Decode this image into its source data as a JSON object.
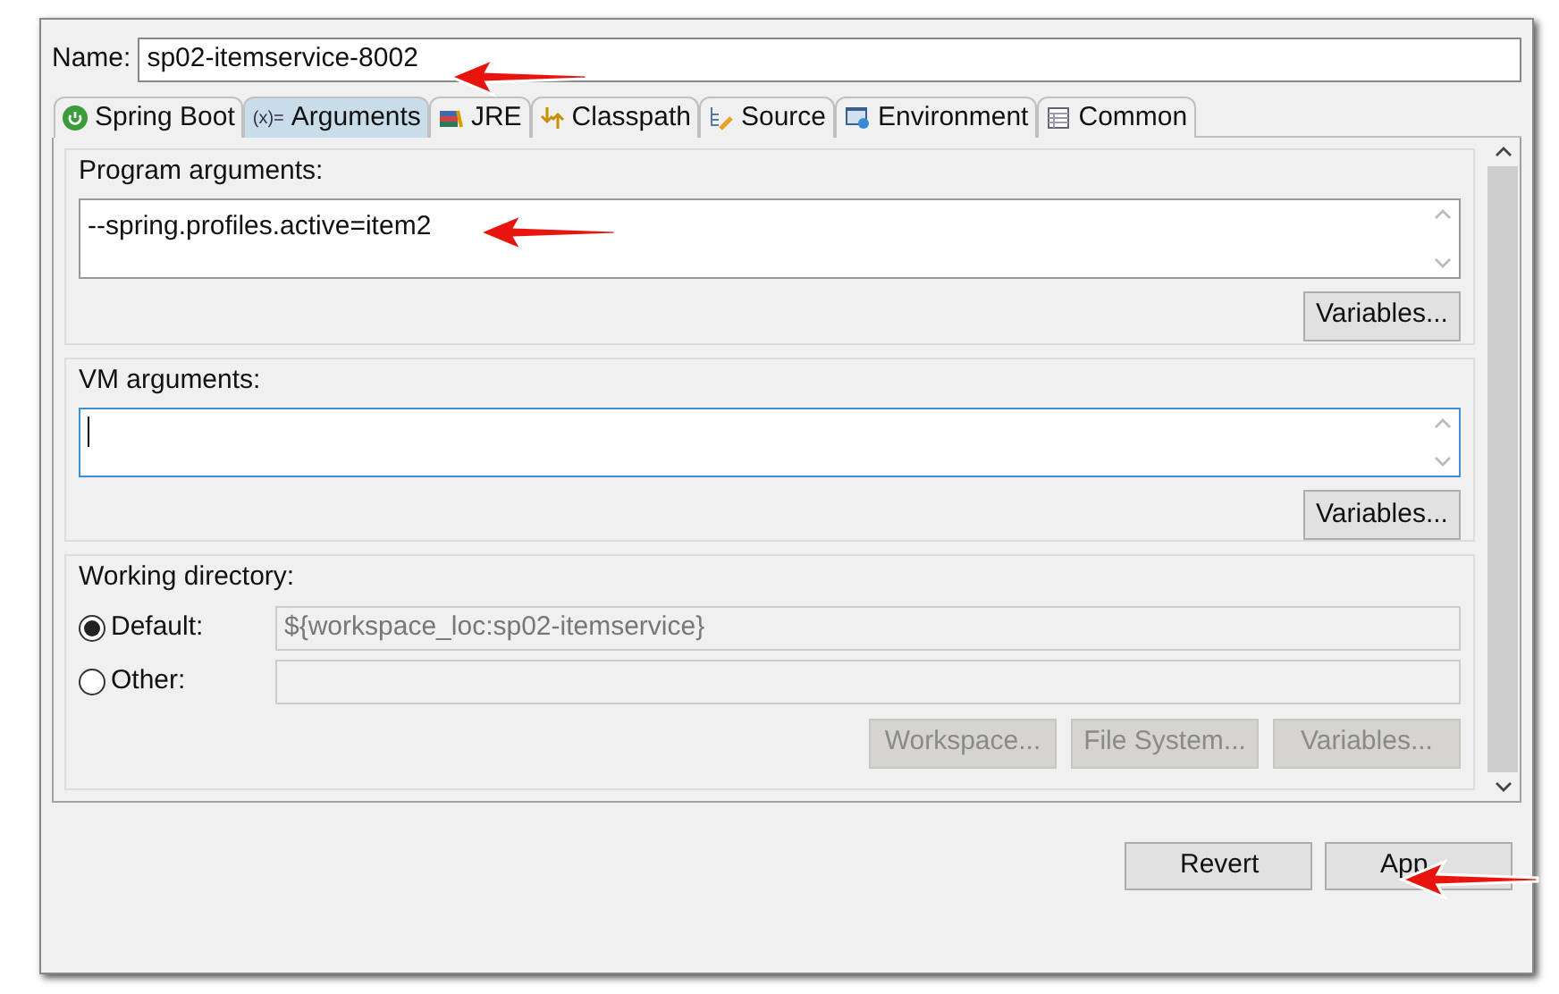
{
  "name_field": {
    "label": "Name:",
    "value": "sp02-itemservice-8002"
  },
  "tabs": [
    {
      "label": "Spring Boot",
      "kind": "spring",
      "selected": false
    },
    {
      "label": "Arguments",
      "kind": "args",
      "icon_text": "(x)=",
      "selected": true
    },
    {
      "label": "JRE",
      "kind": "jre",
      "selected": false
    },
    {
      "label": "Classpath",
      "kind": "classpath",
      "selected": false
    },
    {
      "label": "Source",
      "kind": "source",
      "selected": false
    },
    {
      "label": "Environment",
      "kind": "env",
      "selected": false
    },
    {
      "label": "Common",
      "kind": "common",
      "selected": false
    }
  ],
  "program_arguments": {
    "title": "Program arguments:",
    "value": "--spring.profiles.active=item2",
    "button": "Variables..."
  },
  "vm_arguments": {
    "title": "VM arguments:",
    "focused": true,
    "button": "Variables..."
  },
  "working_directory": {
    "title": "Working directory:",
    "options": [
      {
        "label": "Default:",
        "selected": true,
        "value": "${workspace_loc:sp02-itemservice}"
      },
      {
        "label": "Other:",
        "selected": false
      }
    ],
    "buttons": [
      {
        "label": "Workspace...",
        "disabled": true
      },
      {
        "label": "File System...",
        "disabled": true
      },
      {
        "label": "Variables...",
        "disabled": true
      }
    ]
  },
  "footer_buttons": [
    "Revert",
    "App"
  ]
}
